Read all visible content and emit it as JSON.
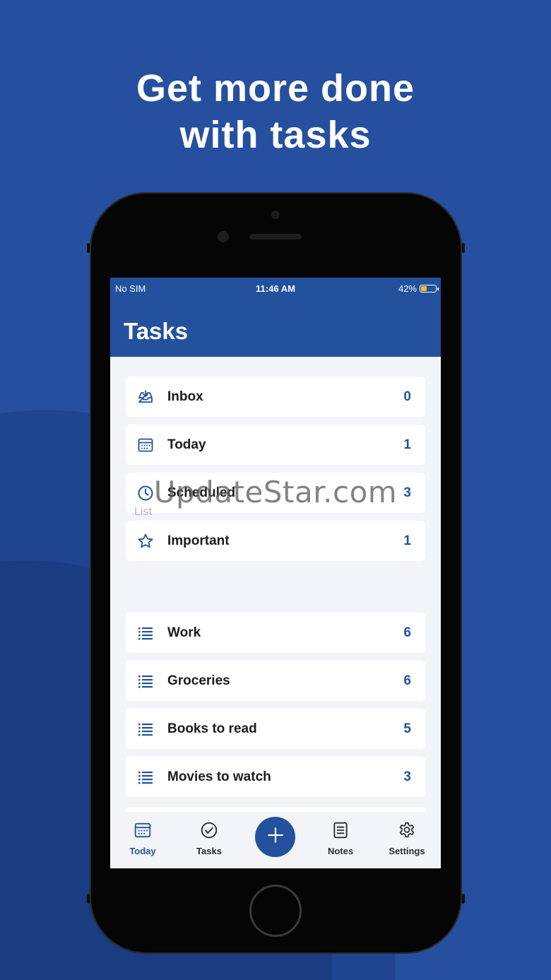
{
  "headline": {
    "line1": "Get more done",
    "line2": "with tasks"
  },
  "status_bar": {
    "carrier": "No SIM",
    "time": "11:46 AM",
    "battery": "42%",
    "battery_level": 0.42
  },
  "header": {
    "title": "Tasks"
  },
  "smart_lists": [
    {
      "label": "Inbox",
      "count": "0",
      "icon": "inbox-icon"
    },
    {
      "label": "Today",
      "count": "1",
      "icon": "calendar-icon"
    },
    {
      "label": "Scheduled",
      "count": "3",
      "icon": "clock-icon"
    },
    {
      "label": "Important",
      "count": "1",
      "icon": "star-icon"
    }
  ],
  "list_section": {
    "label": "List"
  },
  "lists": [
    {
      "label": "Work",
      "count": "6",
      "icon": "list-icon"
    },
    {
      "label": "Groceries",
      "count": "6",
      "icon": "list-icon"
    },
    {
      "label": "Books to read",
      "count": "5",
      "icon": "list-icon"
    },
    {
      "label": "Movies to watch",
      "count": "3",
      "icon": "list-icon"
    }
  ],
  "tabbar": {
    "tabs": [
      {
        "label": "Today",
        "icon": "calendar-icon",
        "active": true
      },
      {
        "label": "Tasks",
        "icon": "check-circle-icon",
        "active": false
      },
      {
        "label": "Notes",
        "icon": "note-icon",
        "active": false
      },
      {
        "label": "Settings",
        "icon": "gear-icon",
        "active": false
      }
    ],
    "add_icon": "plus-icon"
  },
  "watermark": "UpdateStar.com",
  "colors": {
    "background": "#26509f",
    "accent": "#23519d",
    "screen_bg": "#f2f4f8",
    "battery": "#f2c21a"
  }
}
